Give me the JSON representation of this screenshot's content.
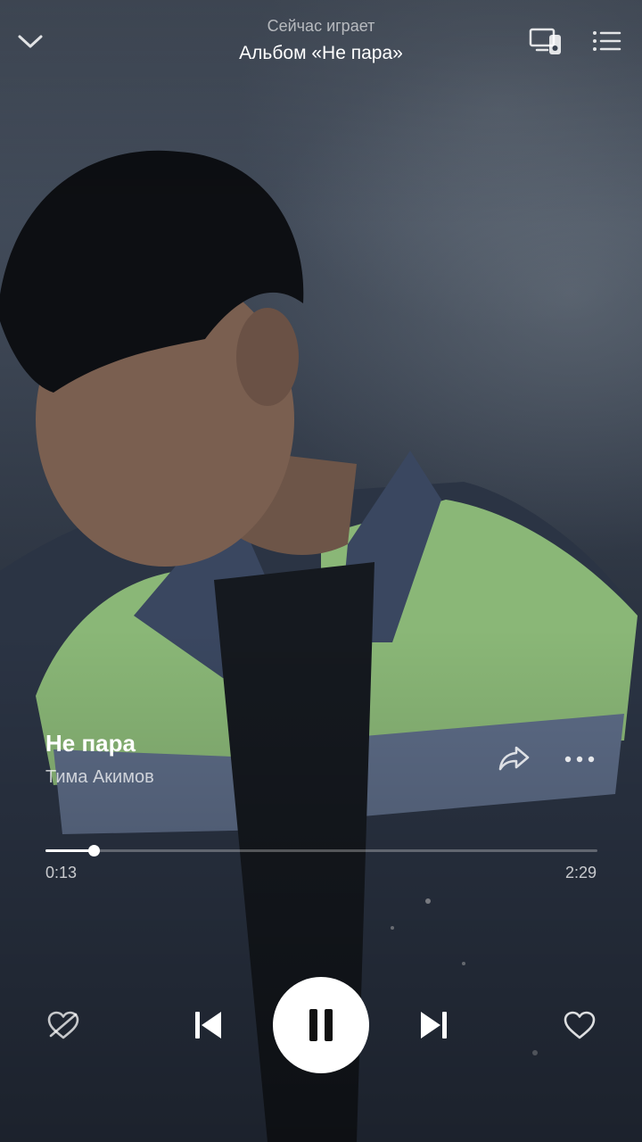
{
  "header": {
    "subtitle": "Сейчас играет",
    "title": "Альбом «Не пара»",
    "icons": {
      "back": "chevron-down-icon",
      "device": "devices-icon",
      "queue": "queue-list-icon"
    }
  },
  "track": {
    "title": "Не пара",
    "artist": "Тима Акимов",
    "icons": {
      "share": "share-icon",
      "more": "more-icon"
    }
  },
  "playback": {
    "current_time": "0:13",
    "total_time": "2:29",
    "progress": 0.087,
    "state": "playing"
  },
  "controls": {
    "icons": {
      "dislike": "dislike-heart-icon",
      "previous": "previous-track-icon",
      "pause": "pause-icon",
      "next": "next-track-icon",
      "like": "heart-icon"
    }
  },
  "colors": {
    "text": "#ffffff",
    "muted_text": "rgba(255,255,255,0.72)",
    "play_button_bg": "#ffffff",
    "jacket_green": "#8fbf7a",
    "jacket_blue": "#5d6c87"
  }
}
